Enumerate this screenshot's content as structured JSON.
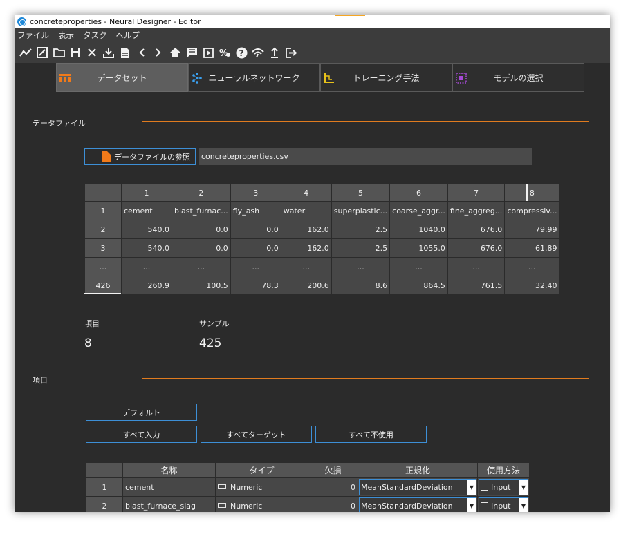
{
  "window": {
    "title": "concreteproperties - Neural Designer - Editor"
  },
  "menu": [
    "ファイル",
    "表示",
    "タスク",
    "ヘルプ"
  ],
  "toolbar_icons": [
    "line-chart-icon",
    "edit-chart-icon",
    "open-folder-icon",
    "save-icon",
    "close-icon",
    "download-icon",
    "document-icon",
    "back-icon",
    "forward-icon",
    "home-icon",
    "comment-icon",
    "play-icon",
    "tasks-icon",
    "help-icon",
    "network-icon",
    "upload-icon",
    "exit-icon"
  ],
  "tabs": [
    {
      "label": "データセット",
      "icon": "dataset-icon",
      "color": "#f07a1a"
    },
    {
      "label": "ニューラルネットワーク",
      "icon": "network-icon",
      "color": "#3aa0f0"
    },
    {
      "label": "トレーニング手法",
      "icon": "training-icon",
      "color": "#e8c21a"
    },
    {
      "label": "モデルの選択",
      "icon": "model-selection-icon",
      "color": "#a64ad6"
    }
  ],
  "data_file": {
    "section_title": "データファイル",
    "browse_label": "データファイルの参照",
    "filename": "concreteproperties.csv",
    "columns": [
      "",
      "1",
      "2",
      "3",
      "4",
      "5",
      "6",
      "7",
      "8"
    ],
    "rows": [
      [
        "1",
        "cement",
        "blast_furnac...",
        "fly_ash",
        "water",
        "superplastic...",
        "coarse_aggr...",
        "fine_aggreg...",
        "compressiv..."
      ],
      [
        "2",
        "540.0",
        "0.0",
        "0.0",
        "162.0",
        "2.5",
        "1040.0",
        "676.0",
        "79.99"
      ],
      [
        "3",
        "540.0",
        "0.0",
        "0.0",
        "162.0",
        "2.5",
        "1055.0",
        "676.0",
        "61.89"
      ],
      [
        "...",
        "...",
        "...",
        "...",
        "...",
        "...",
        "...",
        "...",
        "..."
      ],
      [
        "426",
        "260.9",
        "100.5",
        "78.3",
        "200.6",
        "8.6",
        "864.5",
        "761.5",
        "32.40"
      ]
    ]
  },
  "stats": {
    "variables_label": "項目",
    "variables_value": "8",
    "samples_label": "サンプル",
    "samples_value": "425"
  },
  "variables": {
    "section_title": "項目",
    "default_label": "デフォルト",
    "all_input_label": "すべて入力",
    "all_target_label": "すべてターゲット",
    "all_unused_label": "すべて不使用",
    "columns": [
      "",
      "名称",
      "タイプ",
      "欠損",
      "正規化",
      "使用方法"
    ],
    "rows": [
      {
        "index": "1",
        "name": "cement",
        "type": "Numeric",
        "missing": "0",
        "scaler": "MeanStandardDeviation",
        "use": "Input"
      },
      {
        "index": "2",
        "name": "blast_furnace_slag",
        "type": "Numeric",
        "missing": "0",
        "scaler": "MeanStandardDeviation",
        "use": "Input"
      }
    ]
  }
}
